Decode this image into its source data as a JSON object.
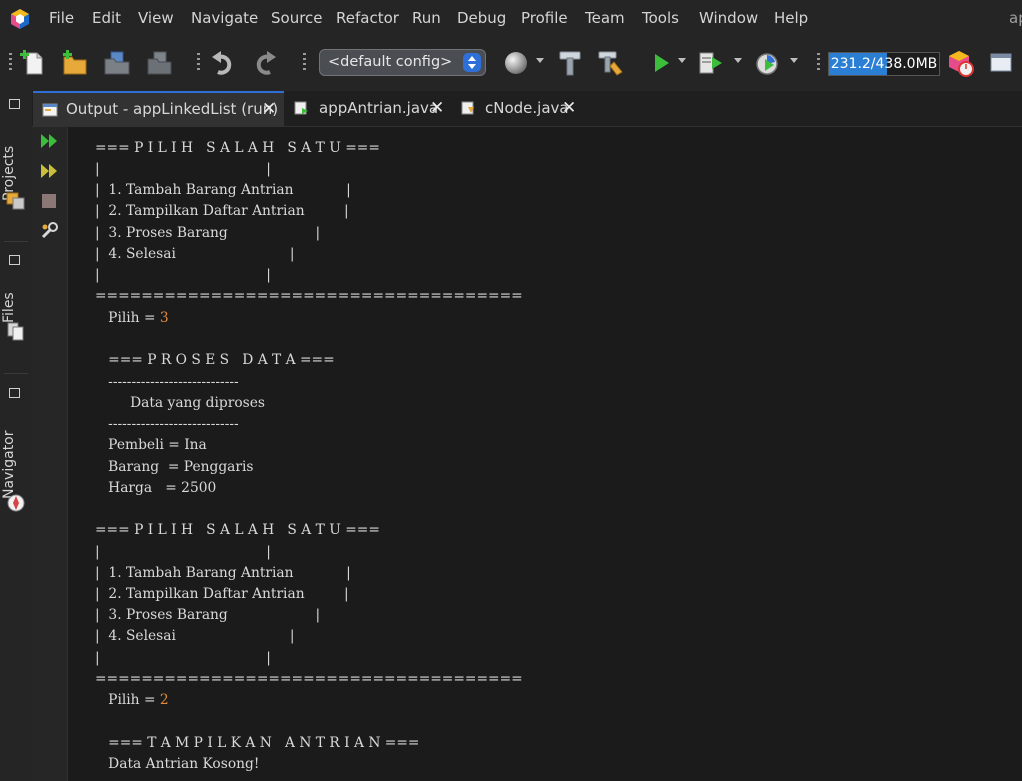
{
  "menu": {
    "items": [
      "File",
      "Edit",
      "View",
      "Navigate",
      "Source",
      "Refactor",
      "Run",
      "Debug",
      "Profile",
      "Team",
      "Tools",
      "Window",
      "Help"
    ],
    "right_text": "ap"
  },
  "toolbar": {
    "config_value": "<default config>",
    "memory_text": "231.2/438.0MB",
    "memory_fraction": 0.528
  },
  "rail": {
    "projects": "Projects",
    "files": "Files",
    "navigator": "Navigator"
  },
  "tabs": [
    {
      "label": "Output - appLinkedList (run)",
      "active": true
    },
    {
      "label": "appAntrian.java",
      "active": false
    },
    {
      "label": "cNode.java",
      "active": false
    }
  ],
  "output": {
    "lines": [
      "=== P I L I H   S A L A H   S A T U ===",
      "|                                      |",
      "|  1. Tambah Barang Antrian            |",
      "|  2. Tampilkan Daftar Antrian         |",
      "|  3. Proses Barang                    |",
      "|  4. Selesai                          |",
      "|                                      |",
      "=====================================",
      "   Pilih = ",
      "",
      "   === P R O S E S   D A T A ===",
      "   ----------------------------",
      "        Data yang diproses",
      "   ----------------------------",
      "   Pembeli = Ina",
      "   Barang  = Penggaris",
      "   Harga   = 2500",
      "",
      "=== P I L I H   S A L A H   S A T U ===",
      "|                                      |",
      "|  1. Tambah Barang Antrian            |",
      "|  2. Tampilkan Daftar Antrian         |",
      "|  3. Proses Barang                    |",
      "|  4. Selesai                          |",
      "|                                      |",
      "=====================================",
      "   Pilih = ",
      "",
      "   === T A M P I L K A N   A N T R I A N ===",
      "   Data Antrian Kosong!"
    ],
    "inputs": {
      "8": "3",
      "26": "2"
    }
  },
  "colors": {
    "accent": "#2f6fd8",
    "input_text": "#e38a3c",
    "console_bg": "#1b1b1b",
    "run_green": "#3cbd3c"
  }
}
